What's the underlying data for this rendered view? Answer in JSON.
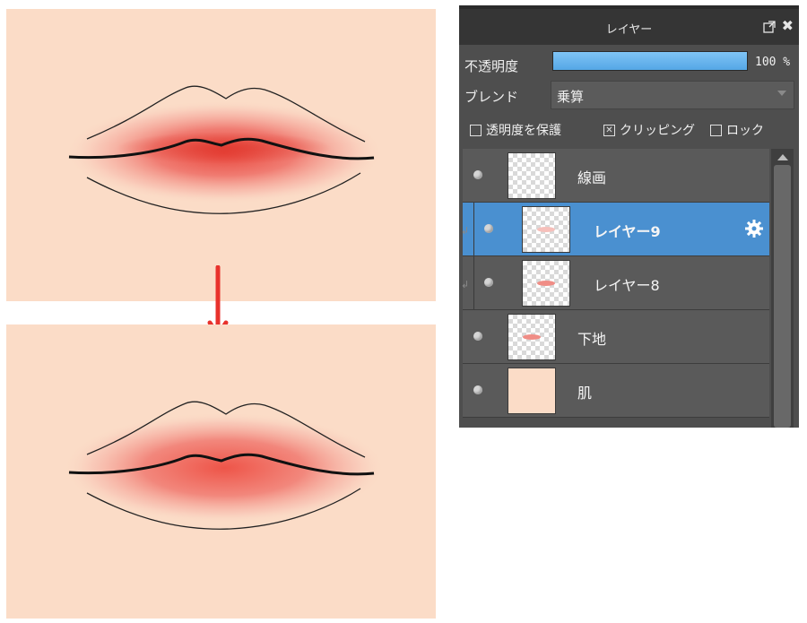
{
  "panel": {
    "title": "レイヤー",
    "opacity_label": "不透明度",
    "opacity_percent": 100,
    "opacity_value": "100 %",
    "blend_label": "ブレンド",
    "blend_value": "乗算",
    "checkboxes": [
      {
        "label": "透明度を保護",
        "checked": false
      },
      {
        "label": "クリッピング",
        "checked": true
      },
      {
        "label": "ロック",
        "checked": false
      }
    ],
    "layers": [
      {
        "name": "線画",
        "visible": true,
        "clipped": false,
        "selected": false
      },
      {
        "name": "レイヤー9",
        "visible": true,
        "clipped": true,
        "selected": true
      },
      {
        "name": "レイヤー8",
        "visible": true,
        "clipped": true,
        "selected": false
      },
      {
        "name": "下地",
        "visible": true,
        "clipped": false,
        "selected": false
      },
      {
        "name": "肌",
        "visible": true,
        "clipped": false,
        "selected": false
      }
    ]
  },
  "colors": {
    "skin": "#fbdcc7",
    "accent": "#4a90d0",
    "arrow": "#e8322c"
  }
}
